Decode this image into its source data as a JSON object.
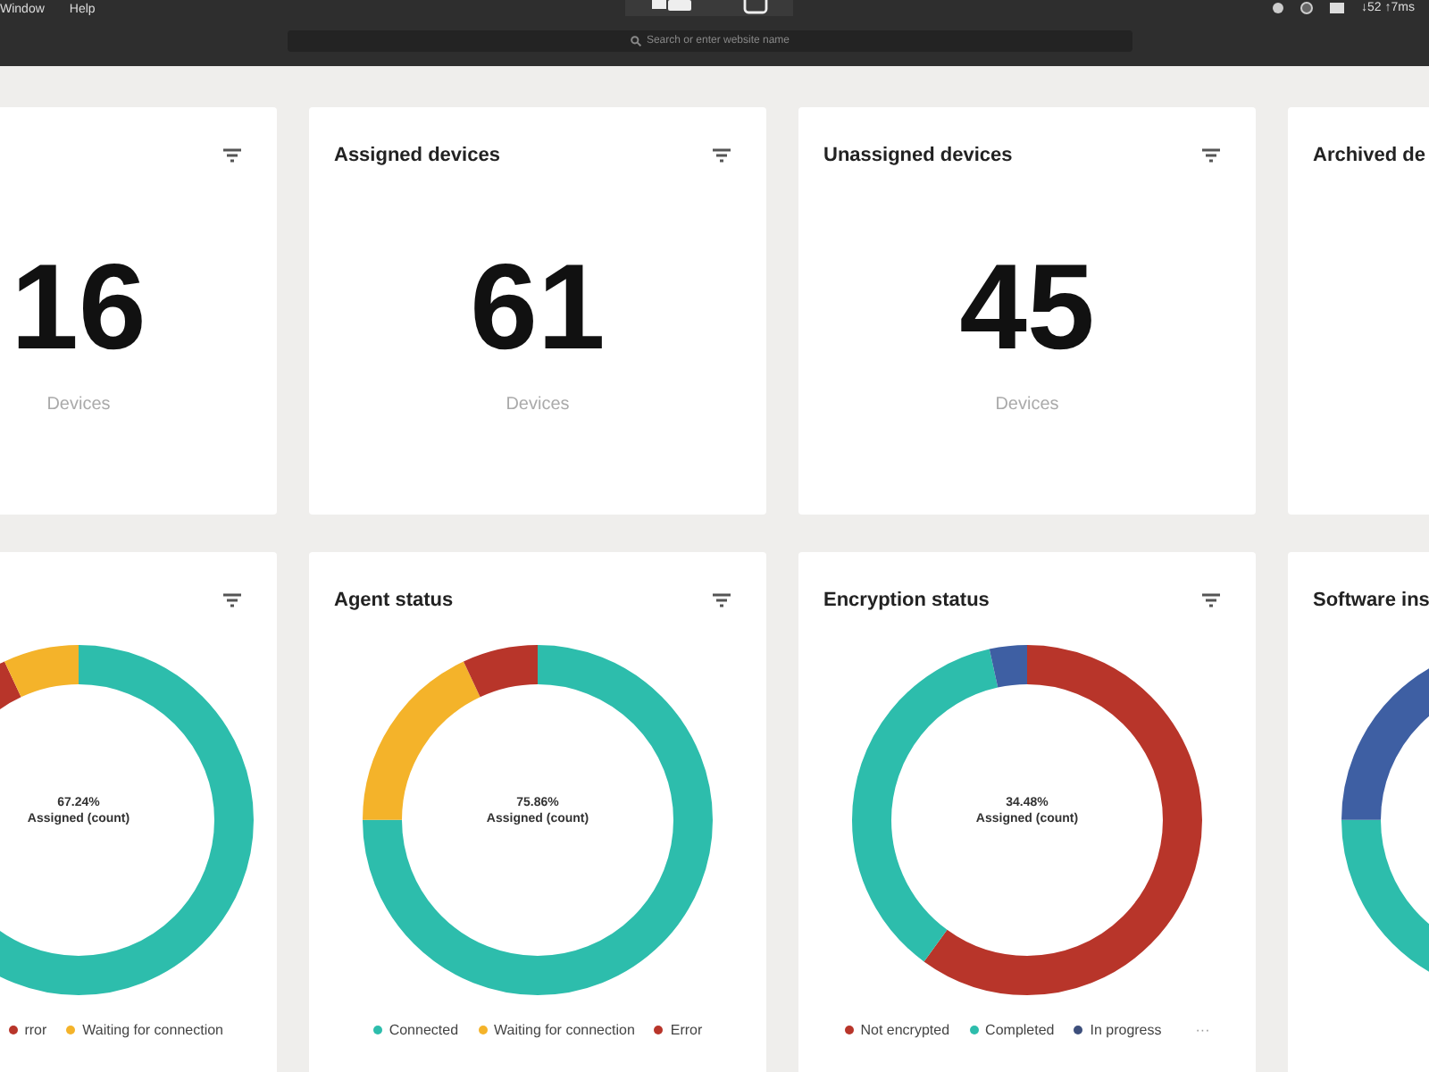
{
  "browser": {
    "menu": [
      "Window",
      "Help"
    ],
    "address_bar": {
      "placeholder": "Search or enter website name"
    },
    "status": "↓52 ↑7ms"
  },
  "count_cards": [
    {
      "filter": true,
      "value": "16",
      "unit": "Devices"
    },
    {
      "title": "Assigned devices",
      "filter": true,
      "value": "61",
      "unit": "Devices"
    },
    {
      "title": "Unassigned devices",
      "filter": true,
      "value": "45",
      "unit": "Devices"
    },
    {
      "title": "Archived de"
    }
  ],
  "chart_cards": [
    {
      "filter": true,
      "percent": "67.24%",
      "caption": "Assigned (count)",
      "legend": [
        {
          "label": "rror",
          "color": "#b8352a"
        },
        {
          "label": "Waiting for connection",
          "color": "#f4b32a"
        }
      ]
    },
    {
      "title": "Agent status",
      "filter": true,
      "percent": "75.86%",
      "caption": "Assigned (count)",
      "legend": [
        {
          "label": "Connected",
          "color": "#2dbdac"
        },
        {
          "label": "Waiting for connection",
          "color": "#f4b32a"
        },
        {
          "label": "Error",
          "color": "#b8352a"
        }
      ]
    },
    {
      "title": "Encryption status",
      "filter": true,
      "percent": "34.48%",
      "caption": "Assigned (count)",
      "legend": [
        {
          "label": "Not encrypted",
          "color": "#b8352a"
        },
        {
          "label": "Completed",
          "color": "#2dbdac"
        },
        {
          "label": "In progress",
          "color": "#3d4f7c"
        }
      ],
      "more": "···"
    },
    {
      "title": "Software ins"
    }
  ]
}
